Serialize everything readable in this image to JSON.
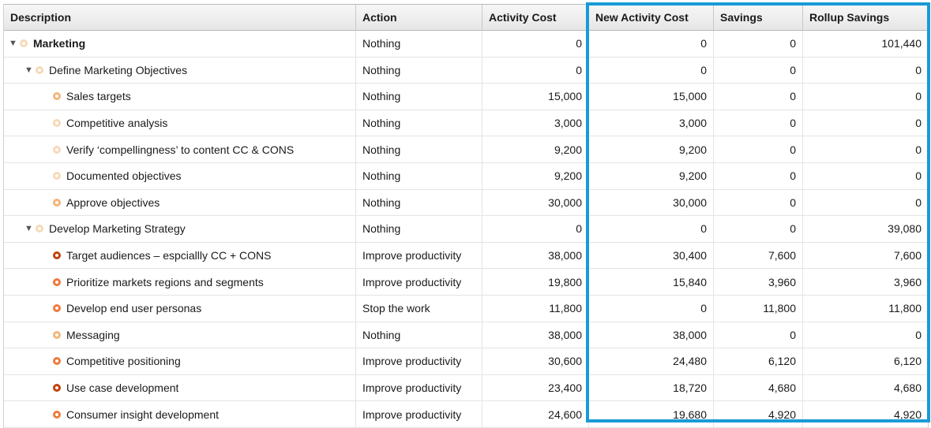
{
  "columns": {
    "description": "Description",
    "action": "Action",
    "activity_cost": "Activity Cost",
    "new_activity_cost": "New Activity Cost",
    "savings": "Savings",
    "rollup_savings": "Rollup Savings"
  },
  "colors": {
    "highlight_border": "#1a9ad6",
    "dot_pale": "#f7d9b8",
    "dot_light": "#f3b57a",
    "dot_medium": "#ee7a3a",
    "dot_dark": "#c2410c"
  },
  "rows": [
    {
      "level": 0,
      "toggle": "▼",
      "icon": "ring-pale",
      "bold": true,
      "description": "Marketing",
      "action": "Nothing",
      "activity_cost": "0",
      "new_activity_cost": "0",
      "savings": "0",
      "rollup_savings": "101,440"
    },
    {
      "level": 1,
      "toggle": "▼",
      "icon": "ring-pale",
      "bold": false,
      "description": "Define Marketing Objectives",
      "action": "Nothing",
      "activity_cost": "0",
      "new_activity_cost": "0",
      "savings": "0",
      "rollup_savings": "0"
    },
    {
      "level": 2,
      "toggle": "",
      "icon": "ring-light",
      "bold": false,
      "description": "Sales targets",
      "action": "Nothing",
      "activity_cost": "15,000",
      "new_activity_cost": "15,000",
      "savings": "0",
      "rollup_savings": "0"
    },
    {
      "level": 2,
      "toggle": "",
      "icon": "ring-pale",
      "bold": false,
      "description": "Competitive analysis",
      "action": "Nothing",
      "activity_cost": "3,000",
      "new_activity_cost": "3,000",
      "savings": "0",
      "rollup_savings": "0"
    },
    {
      "level": 2,
      "toggle": "",
      "icon": "ring-pale",
      "bold": false,
      "description": "Verify ‘compellingness’ to content CC & CONS",
      "action": "Nothing",
      "activity_cost": "9,200",
      "new_activity_cost": "9,200",
      "savings": "0",
      "rollup_savings": "0"
    },
    {
      "level": 2,
      "toggle": "",
      "icon": "ring-pale",
      "bold": false,
      "description": "Documented objectives",
      "action": "Nothing",
      "activity_cost": "9,200",
      "new_activity_cost": "9,200",
      "savings": "0",
      "rollup_savings": "0"
    },
    {
      "level": 2,
      "toggle": "",
      "icon": "ring-light",
      "bold": false,
      "description": "Approve objectives",
      "action": "Nothing",
      "activity_cost": "30,000",
      "new_activity_cost": "30,000",
      "savings": "0",
      "rollup_savings": "0"
    },
    {
      "level": 1,
      "toggle": "▼",
      "icon": "ring-pale",
      "bold": false,
      "description": "Develop Marketing Strategy",
      "action": "Nothing",
      "activity_cost": "0",
      "new_activity_cost": "0",
      "savings": "0",
      "rollup_savings": "39,080"
    },
    {
      "level": 2,
      "toggle": "",
      "icon": "ring-dark",
      "bold": false,
      "description": "Target audiences – espciallly CC + CONS",
      "action": "Improve productivity",
      "activity_cost": "38,000",
      "new_activity_cost": "30,400",
      "savings": "7,600",
      "rollup_savings": "7,600"
    },
    {
      "level": 2,
      "toggle": "",
      "icon": "ring-medium",
      "bold": false,
      "description": "Prioritize markets regions and segments",
      "action": "Improve productivity",
      "activity_cost": "19,800",
      "new_activity_cost": "15,840",
      "savings": "3,960",
      "rollup_savings": "3,960"
    },
    {
      "level": 2,
      "toggle": "",
      "icon": "ring-medium",
      "bold": false,
      "description": "Develop end user personas",
      "action": "Stop the work",
      "activity_cost": "11,800",
      "new_activity_cost": "0",
      "savings": "11,800",
      "rollup_savings": "11,800"
    },
    {
      "level": 2,
      "toggle": "",
      "icon": "ring-light",
      "bold": false,
      "description": "Messaging",
      "action": "Nothing",
      "activity_cost": "38,000",
      "new_activity_cost": "38,000",
      "savings": "0",
      "rollup_savings": "0"
    },
    {
      "level": 2,
      "toggle": "",
      "icon": "ring-medium",
      "bold": false,
      "description": "Competitive positioning",
      "action": "Improve productivity",
      "activity_cost": "30,600",
      "new_activity_cost": "24,480",
      "savings": "6,120",
      "rollup_savings": "6,120"
    },
    {
      "level": 2,
      "toggle": "",
      "icon": "ring-dark",
      "bold": false,
      "description": "Use case development",
      "action": "Improve productivity",
      "activity_cost": "23,400",
      "new_activity_cost": "18,720",
      "savings": "4,680",
      "rollup_savings": "4,680"
    },
    {
      "level": 2,
      "toggle": "",
      "icon": "ring-medium",
      "bold": false,
      "description": "Consumer insight development",
      "action": "Improve productivity",
      "activity_cost": "24,600",
      "new_activity_cost": "19,680",
      "savings": "4,920",
      "rollup_savings": "4,920"
    }
  ]
}
